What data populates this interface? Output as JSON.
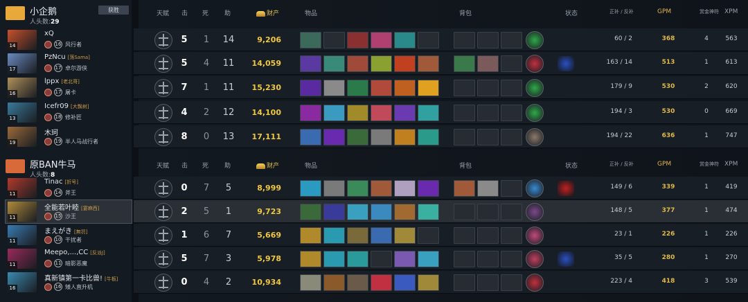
{
  "headers": {
    "talent": "天赋",
    "kills": "击",
    "deaths": "死",
    "assists": "助",
    "networth": "财产",
    "items": "物品",
    "backpack": "背包",
    "status": "状态",
    "lh_dn": "正补 / 反补",
    "gpm": "GPM",
    "courier": "赏金神符",
    "xpm": "XPM"
  },
  "winner_label": "获胜",
  "kills_label": "人头数:",
  "teams": [
    {
      "name": "小企鹅",
      "kills": "29",
      "color": "#e8a83a",
      "players": [
        {
          "name": "xQ",
          "tag": "",
          "hero": "风行者",
          "level": "14",
          "rank": "16",
          "k": "5",
          "d": "1",
          "a": "14",
          "nw": "9,206",
          "lh": "60 / 2",
          "gpm": "368",
          "courier": "4",
          "xpm": "563",
          "hero_color": "#c8502a",
          "items": [
            "#3b6a5a",
            "#272c33",
            "#8a3030",
            "#b04070",
            "#2a8a8a",
            "#272c33"
          ],
          "bp": [
            "#272c33",
            "#272c33",
            "#272c33"
          ],
          "neutral": "#2fa84a",
          "status": ""
        },
        {
          "name": "PzNcu",
          "tag": "[荡Sama]",
          "hero": "卓尔游侠",
          "level": "17",
          "rank": "17",
          "k": "5",
          "d": "4",
          "a": "11",
          "nw": "14,059",
          "lh": "163 / 14",
          "gpm": "513",
          "courier": "1",
          "xpm": "613",
          "hero_color": "#6a8ac0",
          "items": [
            "#5a3aa0",
            "#3a8a7a",
            "#a04a3a",
            "#8aa030",
            "#c04020",
            "#a05a3a"
          ],
          "bp": [
            "#3a7a4a",
            "#7a5a5a",
            "#272c33"
          ],
          "neutral": "#c03040",
          "status": "#2a50c0"
        },
        {
          "name": "lppx",
          "tag": "[老北哥]",
          "hero": "屠卡",
          "level": "16",
          "rank": "17",
          "k": "7",
          "d": "1",
          "a": "11",
          "nw": "15,230",
          "lh": "179 / 9",
          "gpm": "530",
          "courier": "2",
          "xpm": "620",
          "hero_color": "#b0905a",
          "items": [
            "#5a2aa0",
            "#8a8a8a",
            "#2a7a4a",
            "#b04a3a",
            "#c06020",
            "#e0a020"
          ],
          "bp": [
            "#272c33",
            "#272c33",
            "#272c33"
          ],
          "neutral": "#2fa84a",
          "status": ""
        },
        {
          "name": "Icefr09",
          "tag": "[大飘树]",
          "hero": "修补匠",
          "level": "13",
          "rank": "18",
          "k": "4",
          "d": "2",
          "a": "12",
          "nw": "14,100",
          "lh": "194 / 3",
          "gpm": "530",
          "courier": "0",
          "xpm": "669",
          "hero_color": "#3a7a9a",
          "items": [
            "#8a2aa0",
            "#3a9ac0",
            "#a08a2a",
            "#c04a5a",
            "#6a3ab0",
            "#30a0a0"
          ],
          "bp": [
            "#272c33",
            "#272c33",
            "#272c33"
          ],
          "neutral": "#2fa84a",
          "status": ""
        },
        {
          "name": "木珂",
          "tag": "",
          "hero": "半人马战行者",
          "level": "19",
          "rank": "19",
          "k": "8",
          "d": "0",
          "a": "13",
          "nw": "17,111",
          "lh": "194 / 22",
          "gpm": "636",
          "courier": "1",
          "xpm": "747",
          "hero_color": "#9a6a3a",
          "items": [
            "#3a6ab0",
            "#6a2ab0",
            "#3a6a3a",
            "#7a7a7a",
            "#c08020",
            "#2a9a8a"
          ],
          "bp": [
            "#272c33",
            "#272c33",
            "#272c33"
          ],
          "neutral": "#8a7a6a",
          "status": ""
        }
      ]
    },
    {
      "name": "原BAN牛马",
      "kills": "8",
      "color": "#d86a3a",
      "players": [
        {
          "name": "Tinac",
          "tag": "[折号]",
          "hero": "斧王",
          "level": "11",
          "rank": "14",
          "k": "0",
          "d": "7",
          "a": "5",
          "nw": "8,999",
          "lh": "149 / 6",
          "gpm": "339",
          "courier": "1",
          "xpm": "419",
          "hero_color": "#b03a2a",
          "items": [
            "#2a9ac0",
            "#7a7a7a",
            "#3a8a5a",
            "#a05a3a",
            "#b0a0c0",
            "#6a2ab0"
          ],
          "bp": [
            "#a05a3a",
            "#8a8a8a",
            "#272c33"
          ],
          "neutral": "#3a8ad0",
          "status": "#c02020"
        },
        {
          "name": "全能若叶睦",
          "tag": "[宴麻西]",
          "hero": "沙王",
          "level": "11",
          "rank": "15",
          "k": "2",
          "d": "5",
          "a": "1",
          "nw": "9,723",
          "lh": "148 / 5",
          "gpm": "377",
          "courier": "1",
          "xpm": "474",
          "hero_color": "#b08a3a",
          "items": [
            "#3a6a3a",
            "#3a3a9a",
            "#3aa0c0",
            "#3a8ac0",
            "#a06a30",
            "#3ab0a0"
          ],
          "bp": [
            "#272c33",
            "#272c33",
            "#272c33"
          ],
          "neutral": "#7a4a8a",
          "status": ""
        },
        {
          "name": "まえがき",
          "tag": "[無罚]",
          "hero": "干扰者",
          "level": "11",
          "rank": "10",
          "k": "1",
          "d": "6",
          "a": "7",
          "nw": "5,669",
          "lh": "23 / 1",
          "gpm": "226",
          "courier": "1",
          "xpm": "226",
          "hero_color": "#3a7ab0",
          "items": [
            "#b08a2a",
            "#2a9ab0",
            "#7a6a3a",
            "#3a6ab0",
            "#a08a3a",
            "#272c33"
          ],
          "bp": [
            "#272c33",
            "#272c33",
            "#272c33"
          ],
          "neutral": "#c04a7a",
          "status": ""
        },
        {
          "name": "Meepo,...,CC",
          "tag": "[反派J]",
          "hero": "暗影恶魔",
          "level": "11",
          "rank": "11",
          "k": "5",
          "d": "7",
          "a": "3",
          "nw": "5,978",
          "lh": "35 / 5",
          "gpm": "280",
          "courier": "1",
          "xpm": "270",
          "hero_color": "#9a2a5a",
          "items": [
            "#b08a2a",
            "#2a9ab0",
            "#2a9a9a",
            "#272c33",
            "#7a5ab0",
            "#3aa0c0"
          ],
          "bp": [
            "#272c33",
            "#272c33",
            "#272c33"
          ],
          "neutral": "#c04060",
          "status": "#2a50c0"
        },
        {
          "name": "真新镇第一卡比兽!",
          "tag": "[牛板]",
          "hero": "矮人直升机",
          "level": "16",
          "rank": "16",
          "k": "0",
          "d": "4",
          "a": "2",
          "nw": "10,934",
          "lh": "223 / 4",
          "gpm": "418",
          "courier": "3",
          "xpm": "539",
          "hero_color": "#3a8ab0",
          "items": [
            "#8a8a7a",
            "#8a5a2a",
            "#6a5a4a",
            "#c03040",
            "#3a5ac0",
            "#a08a3a"
          ],
          "bp": [
            "#272c33",
            "#272c33",
            "#272c33"
          ],
          "neutral": "#c03040",
          "status": ""
        }
      ]
    }
  ]
}
